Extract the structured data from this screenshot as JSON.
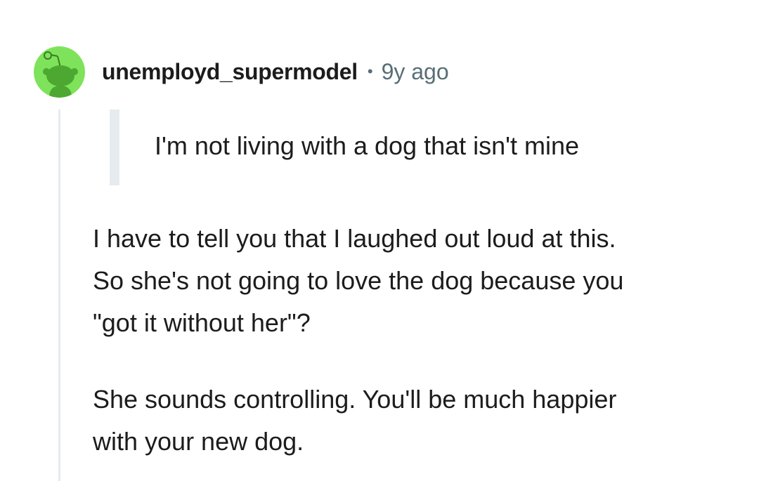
{
  "comment": {
    "username": "unemployd_supermodel",
    "separator": "•",
    "timestamp": "9y ago",
    "quote": "I'm not living with a dog that isn't mine",
    "paragraph1": {
      "lines": [
        "I have to tell you that I laughed out loud at this.",
        "So she's not going to love the dog because you",
        "\"got it without her\"?"
      ]
    },
    "paragraph2": {
      "lines": [
        "She sounds controlling. You'll be much happier",
        "with your new dog."
      ]
    }
  },
  "avatar": {
    "icon": "snoo-avatar-icon",
    "background_color": "#7ee35a",
    "figure_color": "#4da832"
  },
  "colors": {
    "text": "#1c1c1c",
    "meta": "#576f76",
    "rule": "#e5ebee"
  }
}
